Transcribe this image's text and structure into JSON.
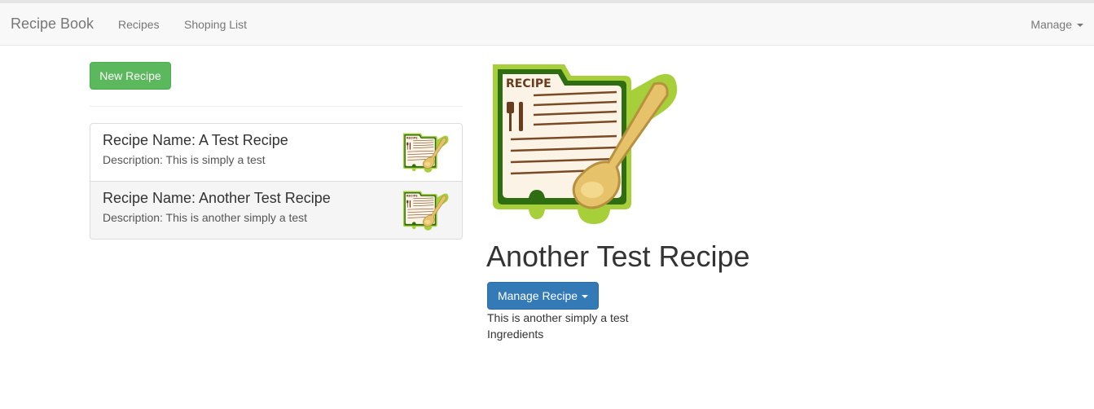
{
  "navbar": {
    "brand": "Recipe Book",
    "links": [
      "Recipes",
      "Shoping List"
    ],
    "manage_label": "Manage"
  },
  "recipe_list": {
    "new_button_label": "New Recipe",
    "items": [
      {
        "name": "Recipe Name: A Test Recipe",
        "description": "Description: This is simply a test",
        "icon": "recipe-card-icon"
      },
      {
        "name": "Recipe Name: Another Test Recipe",
        "description": "Description: This is another simply a test",
        "icon": "recipe-card-icon"
      }
    ]
  },
  "recipe_detail": {
    "title": "Another Test Recipe",
    "manage_button_label": "Manage Recipe",
    "description": "This is another simply a test",
    "ingredients_label": "Ingredients",
    "image_icon": "recipe-card-icon",
    "image_label": "RECIPE"
  },
  "colors": {
    "success": "#5cb85c",
    "primary": "#337ab7",
    "navbar_bg": "#f8f8f8",
    "card_green": "#5a8a1e"
  }
}
